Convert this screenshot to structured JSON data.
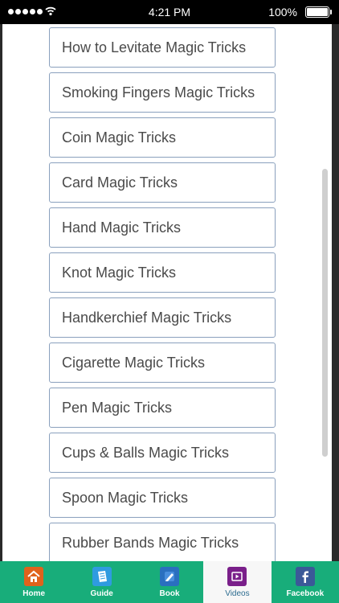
{
  "status_bar": {
    "time": "4:21 PM",
    "battery": "100%"
  },
  "list": {
    "items": [
      {
        "label": "How to Levitate Magic Tricks"
      },
      {
        "label": "Smoking Fingers Magic Tricks"
      },
      {
        "label": "Coin Magic Tricks"
      },
      {
        "label": "Card Magic Tricks"
      },
      {
        "label": "Hand Magic Tricks"
      },
      {
        "label": "Knot Magic Tricks"
      },
      {
        "label": "Handkerchief Magic Tricks"
      },
      {
        "label": "Cigarette Magic Tricks"
      },
      {
        "label": "Pen Magic Tricks"
      },
      {
        "label": "Cups & Balls Magic Tricks"
      },
      {
        "label": "Spoon Magic Tricks"
      },
      {
        "label": "Rubber Bands Magic Tricks"
      }
    ]
  },
  "tabbar": {
    "tabs": [
      {
        "label": "Home",
        "icon": "home-icon",
        "active": false
      },
      {
        "label": "Guide",
        "icon": "guide-icon",
        "active": false
      },
      {
        "label": "Book",
        "icon": "book-icon",
        "active": false
      },
      {
        "label": "Videos",
        "icon": "video-play-icon",
        "active": true
      },
      {
        "label": "Facebook",
        "icon": "facebook-icon",
        "active": false
      }
    ]
  },
  "colors": {
    "tabbar_bg": "#18ad7a",
    "item_border": "#8aa0bd",
    "item_text": "#4a4a4a"
  }
}
